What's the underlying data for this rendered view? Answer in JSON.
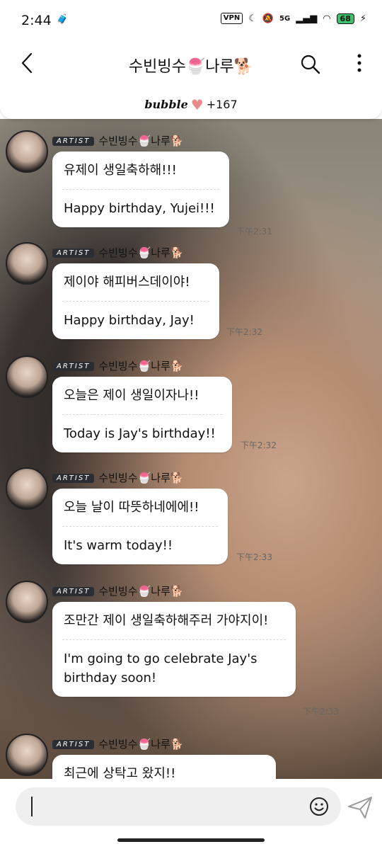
{
  "status": {
    "time": "2:44",
    "vpn": "VPN",
    "net": "5G",
    "battery": "68"
  },
  "header": {
    "title": "수빈빙수🍧나루🐕",
    "back_icon": "chevron-left-icon",
    "brand": "bubble",
    "likes": "+167"
  },
  "messages": [
    {
      "badge": "ARTIST",
      "name": "수빈빙수🍧나루🐕",
      "ko": "유제이 생일축하해!!!",
      "en": "Happy birthday, Yujei!!!",
      "time": "下午2:31"
    },
    {
      "badge": "ARTIST",
      "name": "수빈빙수🍧나루🐕",
      "ko": "제이야 해피버스데이야!",
      "en": "Happy birthday, Jay!",
      "time": "下午2:32"
    },
    {
      "badge": "ARTIST",
      "name": "수빈빙수🍧나루🐕",
      "ko": "오늘은 제이 생일이자나!!",
      "en": "Today is Jay's birthday!!",
      "time": "下午2:32"
    },
    {
      "badge": "ARTIST",
      "name": "수빈빙수🍧나루🐕",
      "ko": "오늘 날이 따뜻하네에에!!",
      "en": "It's warm today!!",
      "time": "下午2:33"
    },
    {
      "badge": "ARTIST",
      "name": "수빈빙수🍧나루🐕",
      "ko": "조만간 제이 생일축하해주러 가야지이!",
      "en": "I'm going to go celebrate Jay's birthday soon!",
      "time": "下午2:33"
    },
    {
      "badge": "ARTIST",
      "name": "수빈빙수🍧나루🐕",
      "ko": "최근에 상탁고 왔지!!",
      "en": "",
      "time": ""
    }
  ],
  "input": {
    "placeholder": ""
  }
}
